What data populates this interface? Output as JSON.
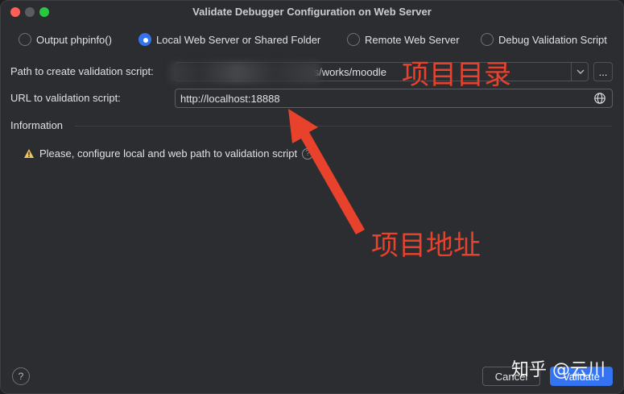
{
  "window": {
    "title": "Validate Debugger Configuration on Web Server"
  },
  "radios": [
    {
      "label": "Output phpinfo()",
      "selected": false
    },
    {
      "label": "Local Web Server or Shared Folder",
      "selected": true
    },
    {
      "label": "Remote Web Server",
      "selected": false
    },
    {
      "label": "Debug Validation Script",
      "selected": false
    }
  ],
  "form": {
    "path_label": "Path to create validation script:",
    "path_value_visible": "ts/works/moodle",
    "more_button": "...",
    "url_label": "URL to validation script:",
    "url_value": "http://localhost:18888"
  },
  "information": {
    "title": "Information",
    "warning_text": "Please, configure local and web path to validation script"
  },
  "footer": {
    "help": "?",
    "cancel": "Cancel",
    "validate": "Validate"
  },
  "annotations": {
    "project_dir": "项目目录",
    "project_url": "项目地址"
  },
  "watermark": "知乎 @云川",
  "colors": {
    "accent": "#3574f0",
    "annotation": "#e8412c",
    "warning": "#f2c55c"
  },
  "icons": [
    "chevron-down-icon",
    "globe-icon",
    "warning-icon",
    "help-icon"
  ]
}
